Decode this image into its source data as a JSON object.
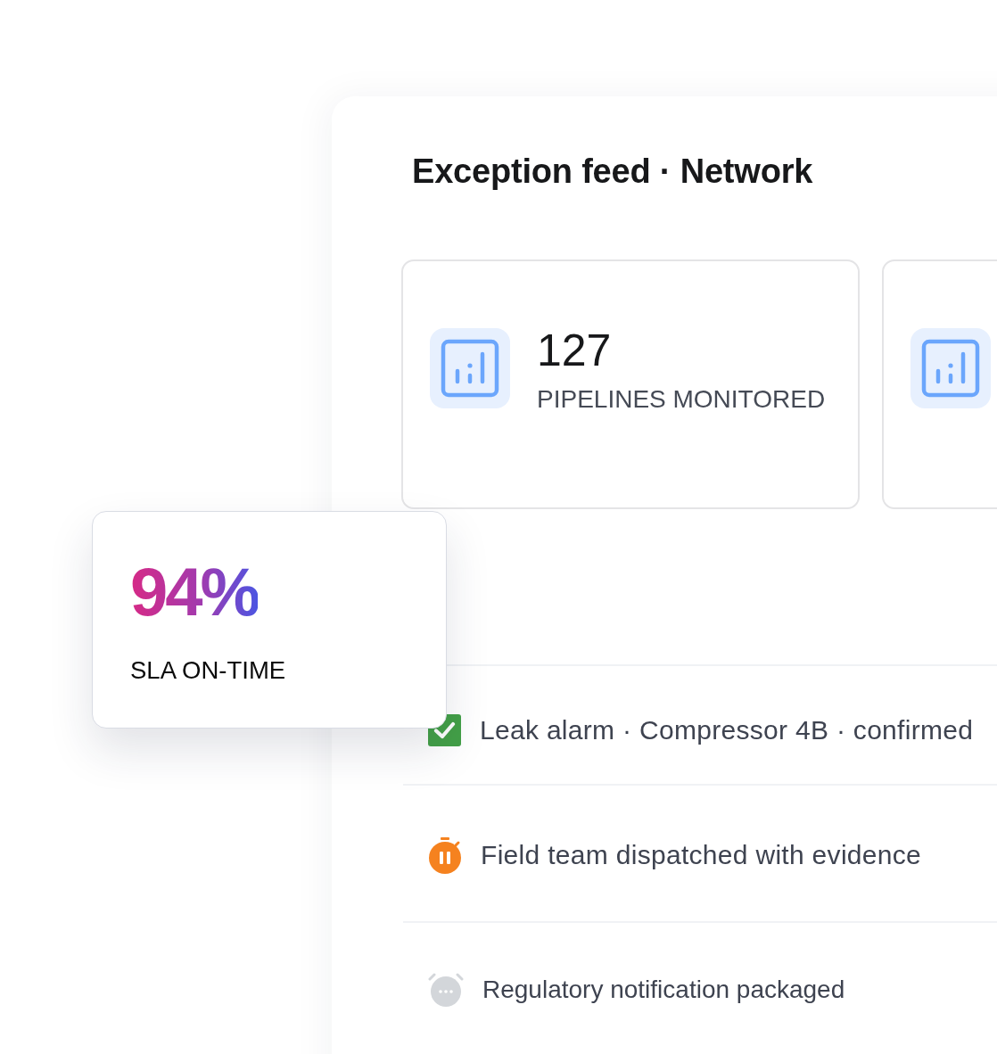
{
  "panel": {
    "title": "Exception feed · Network"
  },
  "stat_cards": [
    {
      "kind": "chart",
      "value": "127",
      "label": "PIPELINES MONITORED"
    },
    {
      "kind": "chart"
    }
  ],
  "floating_card": {
    "value": "94%",
    "label": "SLA ON-TIME"
  },
  "feed": [
    {
      "kind": "confirmed",
      "text": "Leak alarm · Compressor 4B · confirmed"
    },
    {
      "kind": "in_progress",
      "text": "Field team dispatched with evidence"
    },
    {
      "kind": "pending",
      "text": "Regulatory notification packaged"
    }
  ]
}
